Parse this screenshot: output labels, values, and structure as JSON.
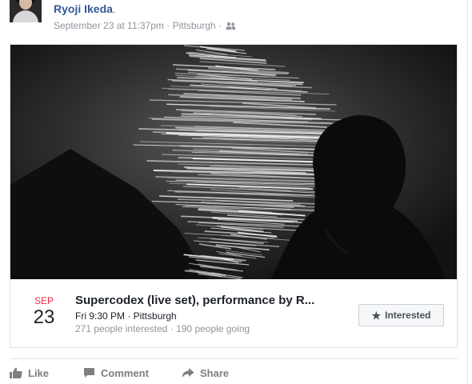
{
  "post": {
    "author_name": "Ryoji Ikeda",
    "author_suffix": ".",
    "timestamp": "September 23 at 11:37pm",
    "location": "Pittsburgh",
    "separator": "·",
    "audience_icon": "friends-icon"
  },
  "event": {
    "month": "SEP",
    "day": "23",
    "title": "Supercodex (live set), performance by R...",
    "when": "Fri 9:30 PM · Pittsburgh",
    "stats": "271 people interested · 190 people going",
    "interested_label": "Interested",
    "interested_icon": "star-icon"
  },
  "actions": {
    "like": "Like",
    "comment": "Comment",
    "share": "Share"
  },
  "colors": {
    "link": "#365899",
    "month": "#f02849",
    "meta": "#90949c",
    "action": "#7f7f7f"
  }
}
